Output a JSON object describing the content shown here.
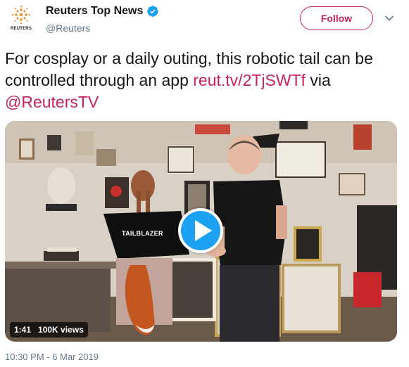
{
  "account": {
    "display_name": "Reuters Top News",
    "handle": "@Reuters",
    "avatar_text": "REUTERS",
    "verified": true
  },
  "actions": {
    "follow_label": "Follow",
    "caret_icon": "chevron-down-icon"
  },
  "tweet": {
    "text_before": "For cosplay or a daily outing, this robotic tail can be controlled through an app ",
    "link": "reut.tv/2TjSWTf",
    "via": " via ",
    "mention": "@ReutersTV"
  },
  "video": {
    "duration": "1:41",
    "views": "100K views",
    "shirt_text": "TAILBLAZER"
  },
  "timestamp": "10:30 PM - 6 Mar 2019",
  "colors": {
    "accent": "#c7245b",
    "verified": "#1da1f2",
    "play": "#1da1f2",
    "secondary_text": "#657786"
  }
}
